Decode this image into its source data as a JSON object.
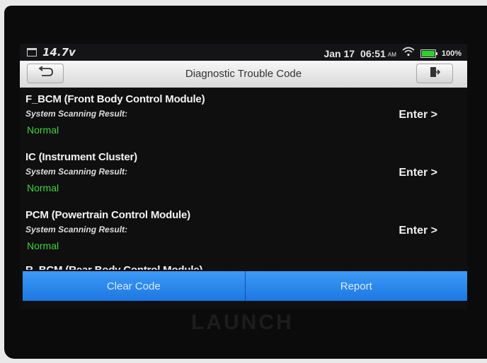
{
  "status_bar": {
    "voltage": "14.7v",
    "date": "Jan 17",
    "time": "06:51",
    "ampm": "AM",
    "battery_level": "100%",
    "battery_color": "#2fd12f"
  },
  "title_bar": {
    "title": "Diagnostic Trouble Code",
    "back_icon": "back-arrow-icon",
    "exit_icon": "exit-door-icon"
  },
  "modules": [
    {
      "name": "F_BCM (Front Body Control Module)",
      "result_label": "System Scanning Result:",
      "status": "Normal",
      "action": "Enter >"
    },
    {
      "name": "IC (Instrument Cluster)",
      "result_label": "System Scanning Result:",
      "status": "Normal",
      "action": "Enter >"
    },
    {
      "name": "PCM (Powertrain Control Module)",
      "result_label": "System Scanning Result:",
      "status": "Normal",
      "action": "Enter >"
    },
    {
      "name": "R_BCM (Rear Body Control Module)"
    }
  ],
  "actions": {
    "clear_code": "Clear Code",
    "report": "Report"
  },
  "brand": "LAUNCH",
  "colors": {
    "status_normal": "#3ed23e",
    "action_blue": "#2a89ee"
  }
}
